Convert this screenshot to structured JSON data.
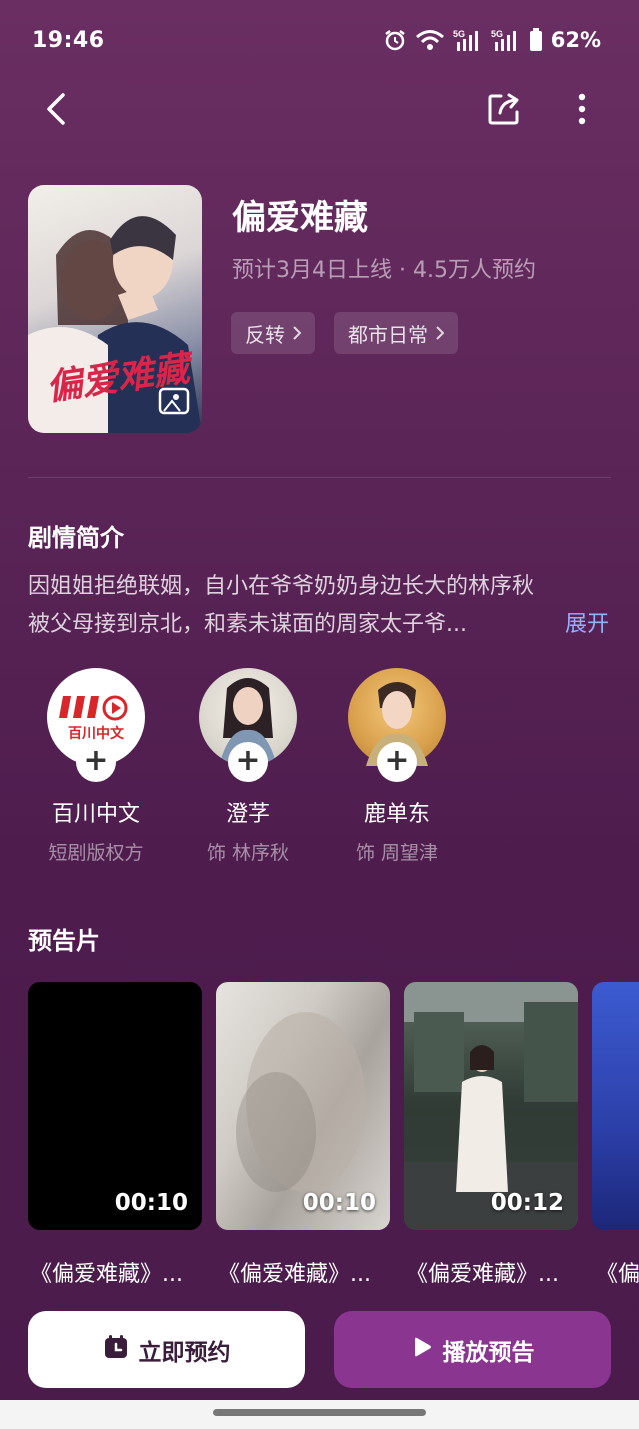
{
  "status_bar": {
    "time": "19:46",
    "battery": "62%",
    "icons": [
      "alarm-icon",
      "wifi-icon",
      "5g-signal-icon",
      "5g-signal-icon",
      "battery-icon"
    ]
  },
  "nav": {
    "back_icon": "back-arrow-icon",
    "share_icon": "share-icon",
    "more_icon": "more-vertical-icon"
  },
  "drama": {
    "title": "偏爱难藏",
    "subtitle": "预计3月4日上线 · 4.5万人预约",
    "tags": [
      "反转",
      "都市日常"
    ],
    "poster_text": "偏爱难藏"
  },
  "synopsis": {
    "heading": "剧情简介",
    "line1": "因姐姐拒绝联姻，自小在爷爷奶奶身边长大的林序秋",
    "line2": "被父母接到京北，和素未谋面的周家太子爷...",
    "expand_label": "展开"
  },
  "cast": [
    {
      "name": "百川中文",
      "role": "短剧版权方",
      "logo_text": "百川中文"
    },
    {
      "name": "澄芓",
      "role": "饰 林序秋"
    },
    {
      "name": "鹿单东",
      "role": "饰 周望津"
    }
  ],
  "trailers_section": {
    "heading": "预告片",
    "items": [
      {
        "duration": "00:10",
        "title": "《偏爱难藏》..."
      },
      {
        "duration": "00:10",
        "title": "《偏爱难藏》..."
      },
      {
        "duration": "00:12",
        "title": "《偏爱难藏》..."
      },
      {
        "duration": "",
        "title": "《偏"
      }
    ]
  },
  "actions": {
    "reserve_label": "立即预约",
    "play_label": "播放预告"
  },
  "colors": {
    "background": "#5a2456",
    "accent_button": "#8a3590",
    "expand_link": "#8db4ff"
  }
}
